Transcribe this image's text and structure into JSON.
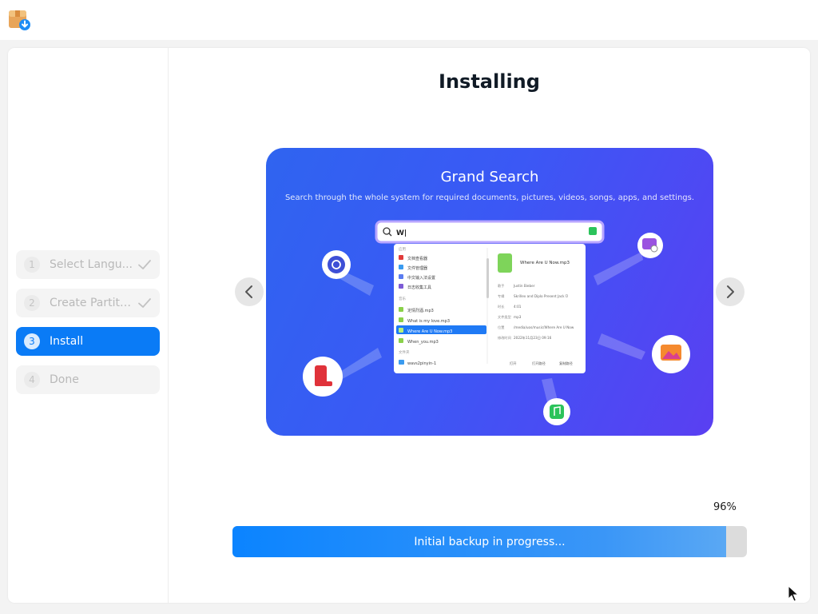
{
  "window": {
    "app_icon": "installer-box-icon"
  },
  "sidebar": {
    "steps": [
      {
        "number": "1",
        "label": "Select Langu...",
        "state": "done"
      },
      {
        "number": "2",
        "label": "Create Partiti...",
        "state": "done"
      },
      {
        "number": "3",
        "label": "Install",
        "state": "active"
      },
      {
        "number": "4",
        "label": "Done",
        "state": "pending"
      }
    ]
  },
  "main": {
    "title": "Installing",
    "slide": {
      "title": "Grand Search",
      "subtitle": "Search through the whole system for required documents, pictures, videos, songs, apps, and settings.",
      "search_text": "W|",
      "list_sections": [
        "应用",
        "音乐",
        "文件夹"
      ],
      "list_items": [
        "文档查看器",
        "文件管理器",
        "中文输入法设置",
        "日志收集工具",
        "定情烈酒.mp3",
        "What is my love.mp3",
        "Where Are U Now.mp3",
        "When_you.mp3",
        "wavs2pinyin-1"
      ],
      "detail_title": "Where Are U Now.mp3",
      "detail_labels": [
        "歌手",
        "专辑",
        "时长",
        "文件类型",
        "位置",
        "修改时间"
      ],
      "detail_values": [
        "Justin Bieber",
        "Skrillex and Diplo Present Jack Ü",
        "4:01",
        "mp3",
        "/media/uos/music/Where Are U Now",
        "2022年11月23日 09:16"
      ],
      "detail_actions": [
        "打开",
        "打开路径",
        "复制路径"
      ]
    },
    "prev_icon": "chevron-left-icon",
    "next_icon": "chevron-right-icon"
  },
  "progress": {
    "percent_label": "96%",
    "value": 0.96,
    "status_text": "Initial backup in progress..."
  },
  "colors": {
    "accent": "#0a7bf6",
    "slide_gradient_start": "#2f64f0",
    "slide_gradient_end": "#5a3ff2"
  }
}
